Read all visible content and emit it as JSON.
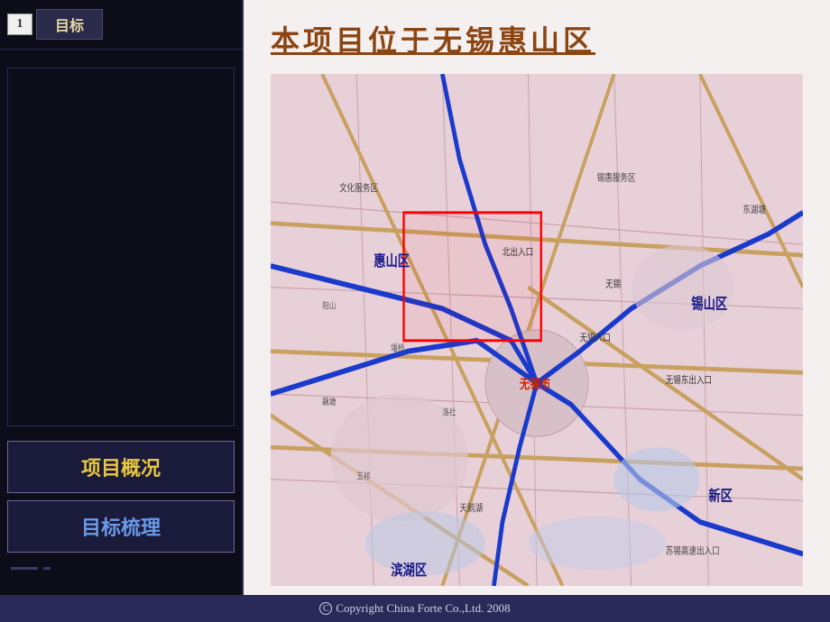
{
  "sidebar": {
    "step_number": "1",
    "step_label": "目标",
    "nav_items": [
      {
        "id": "project",
        "label": "项目概况",
        "style": "project"
      },
      {
        "id": "goals",
        "label": "目标梳理",
        "style": "goals"
      }
    ]
  },
  "content": {
    "title": "本项目位于无锡惠山区",
    "map_labels": [
      {
        "id": "huishan",
        "text": "惠山区"
      },
      {
        "id": "xishan",
        "text": "锡山区"
      },
      {
        "id": "xinqu",
        "text": "新区"
      },
      {
        "id": "binhu",
        "text": "滨湖区"
      },
      {
        "id": "wuxi",
        "text": "无锡市"
      }
    ]
  },
  "footer": {
    "copyright_text": "Copyright  China  Forte  Co.,Ltd.  2008",
    "copyright_symbol": "C"
  }
}
